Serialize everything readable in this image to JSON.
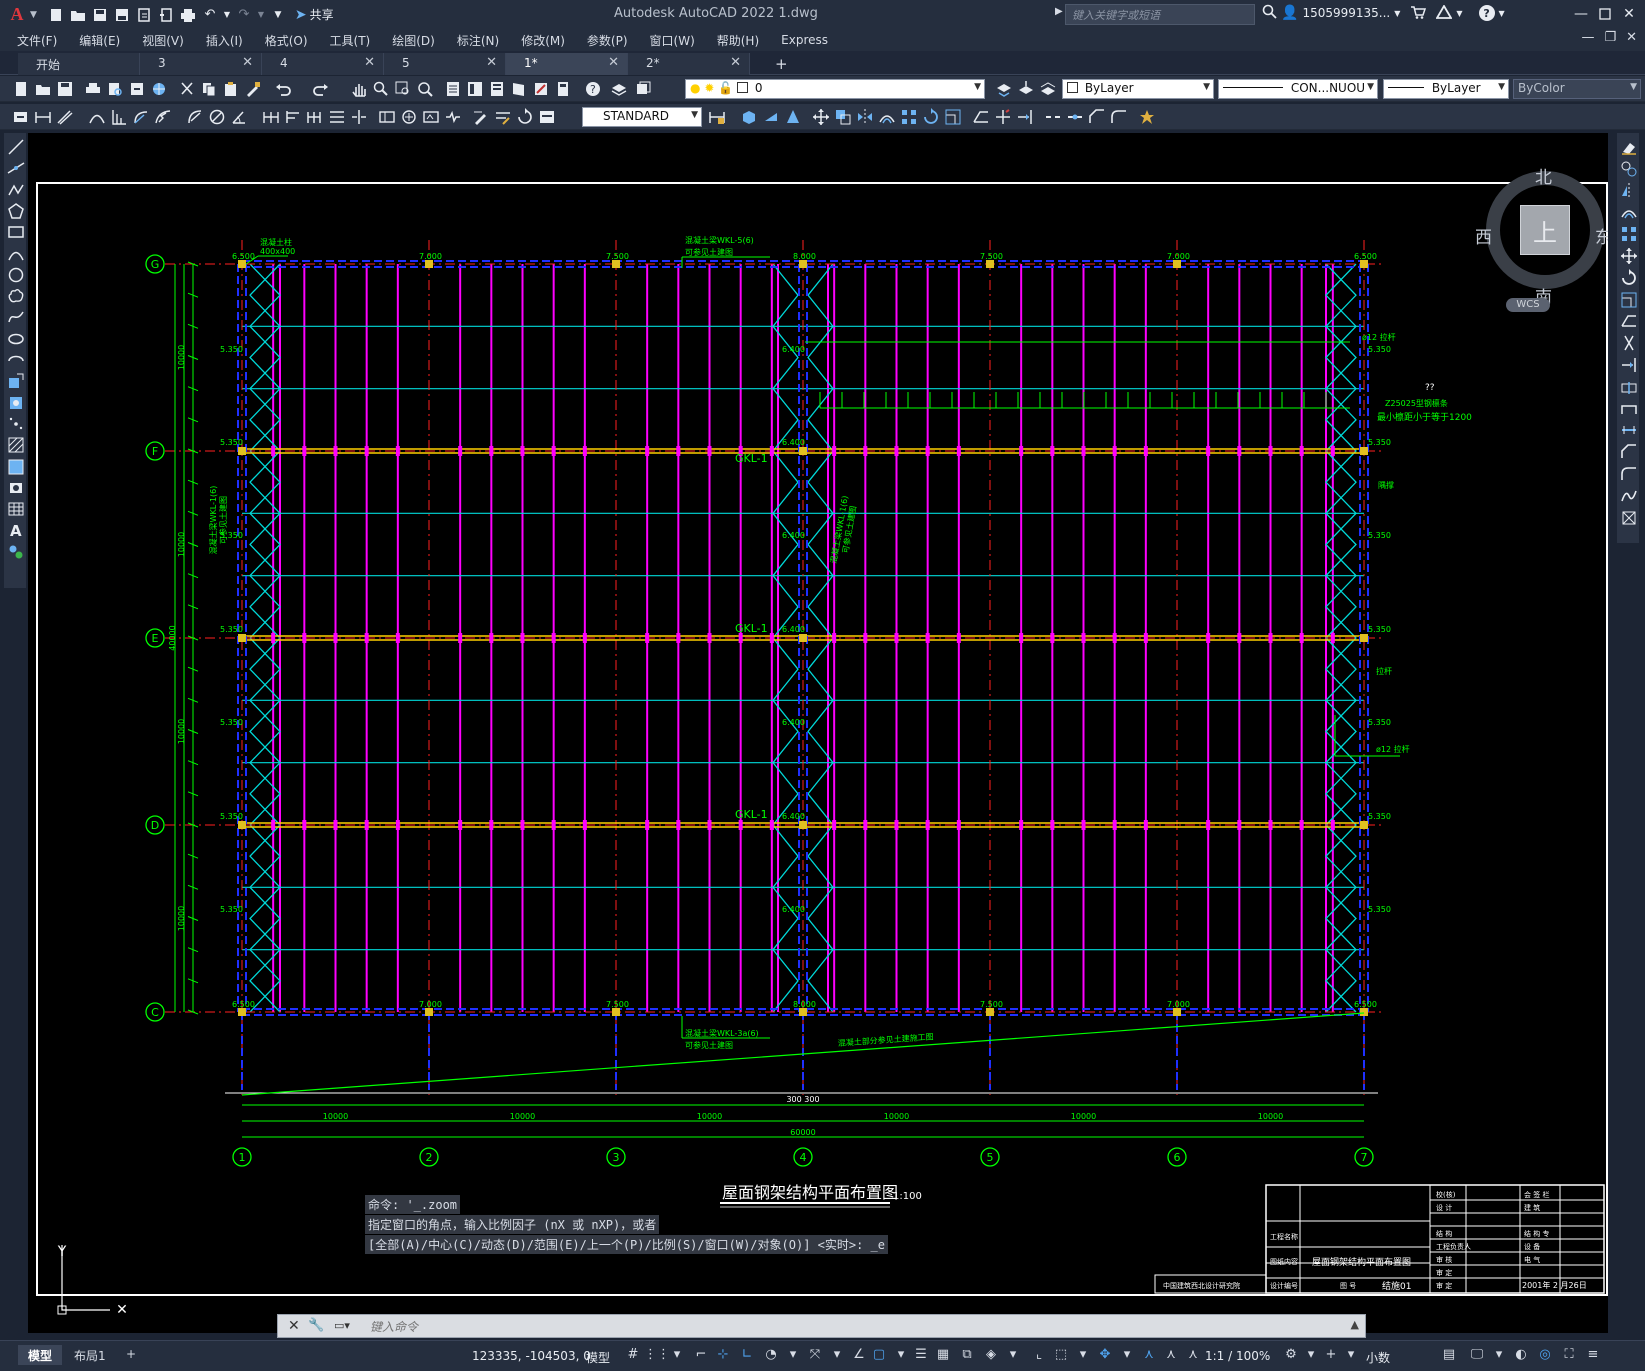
{
  "window": {
    "title": "Autodesk AutoCAD 2022    1.dwg",
    "search_placeholder": "键入关键字或短语",
    "user": "1505999135...",
    "share_label": "共享",
    "help_label": "?"
  },
  "menu": [
    "文件(F)",
    "编辑(E)",
    "视图(V)",
    "插入(I)",
    "格式(O)",
    "工具(T)",
    "绘图(D)",
    "标注(N)",
    "修改(M)",
    "参数(P)",
    "窗口(W)",
    "帮助(H)",
    "Express"
  ],
  "file_tabs": [
    {
      "label": "开始",
      "closable": false,
      "active": false
    },
    {
      "label": "3",
      "closable": true,
      "active": false
    },
    {
      "label": "4",
      "closable": true,
      "active": false
    },
    {
      "label": "5",
      "closable": true,
      "active": false
    },
    {
      "label": "1*",
      "closable": true,
      "active": true
    },
    {
      "label": "2*",
      "closable": true,
      "active": false
    }
  ],
  "properties": {
    "layer": "0",
    "color": "ByLayer",
    "linetype": "CON...NUOU",
    "lineweight": "ByLayer",
    "plotstyle": "ByColor",
    "textstyle": "STANDARD"
  },
  "viewcube": {
    "north": "北",
    "south": "南",
    "east": "东",
    "west": "西",
    "top": "上",
    "wcs": "WCS"
  },
  "drawing": {
    "title": "屋面钢架结构平面布置图",
    "scale": "1:100",
    "grid_rows": [
      "G",
      "F",
      "E",
      "D",
      "C"
    ],
    "grid_cols": [
      "1",
      "2",
      "3",
      "4",
      "5",
      "6",
      "7"
    ],
    "total_dim": "60000",
    "bay_dim": "10000",
    "beam_label": "GKL-1",
    "col_elevations": [
      "6.500",
      "7.000",
      "7.500",
      "8.000",
      "7.500",
      "7.000",
      "6.500"
    ],
    "mid_elevations": [
      "5.350",
      "6.400",
      "5.350"
    ],
    "notes": {
      "column_note_1": "混凝土柱",
      "column_note_2": "400x400",
      "top_beam_note_1": "混凝土梁WKL-5(6)",
      "top_beam_note_2": "可参见土建图",
      "bottom_beam_note_1": "混凝土梁WKL-3a(6)",
      "bottom_beam_note_2": "可参见土建图",
      "slope_note": "混凝土部分参见土建施工图",
      "rod_note": "ø12 拉杆",
      "purlin_note_1": "Z25025型钢檩条",
      "purlin_note_2": "最小檩距小于等于1200",
      "brace_note": "隅撑",
      "tie_note": "拉杆",
      "rod_note_2": "ø12 拉杆",
      "side_note_1": "混凝土梁WKL-1(6)",
      "side_note_2": "可参见土建图",
      "question_mark": "??",
      "center_dims": "300 300",
      "side_dim_left": "40000"
    },
    "title_block": {
      "project_label": "工程名称",
      "drawing_label": "图纸内容",
      "drawing_name": "屋面钢架结构平面布置图",
      "number_label": "设计编号",
      "sheet_no": "结施01",
      "date": "2001年 2 月26日",
      "dwg_no_label": "图 号",
      "company": "中国建筑西北设计研究院",
      "cells": [
        "校(核)",
        "会 签 栏",
        "设 计",
        "建 筑",
        "结 构",
        "结 构 专",
        "工程负责人",
        "设 备",
        "审 核",
        "电 气",
        "审 定",
        "审 定"
      ]
    }
  },
  "command": {
    "history": [
      "命令: '_.zoom",
      "指定窗口的角点，输入比例因子 (nX 或 nXP)，或者",
      "[全部(A)/中心(C)/动态(D)/范围(E)/上一个(P)/比例(S)/窗口(W)/对象(O)] <实时>: _e"
    ],
    "placeholder": "键入命令"
  },
  "status": {
    "layout_tabs": [
      "模型",
      "布局1"
    ],
    "coords": "123335, -104503, 0",
    "model_label": "模型",
    "scale": "1:1 / 100%",
    "units": "小数"
  },
  "colors": {
    "purlin": "#ff00ff",
    "brace": "#00d8d8",
    "axis": "#ff2020",
    "dim": "#00ff00",
    "beam": "#ffd000",
    "blue_beam": "#2030ff"
  }
}
